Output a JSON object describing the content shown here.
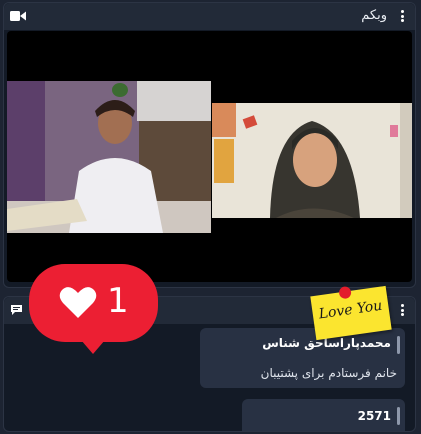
{
  "webcam_panel": {
    "title": "وبکم",
    "icon": "video-camera-icon"
  },
  "chat_panel": {
    "icon": "chat-icon",
    "messages": [
      {
        "name": "محمدپاراساحق شناس",
        "text": "خانم فرستادم برای پشتیبان"
      },
      {
        "name": "2571",
        "text": ""
      }
    ]
  },
  "reaction": {
    "icon": "heart-icon",
    "count": "1",
    "color": "#ec1f33"
  },
  "sticker": {
    "text": "Love You"
  }
}
